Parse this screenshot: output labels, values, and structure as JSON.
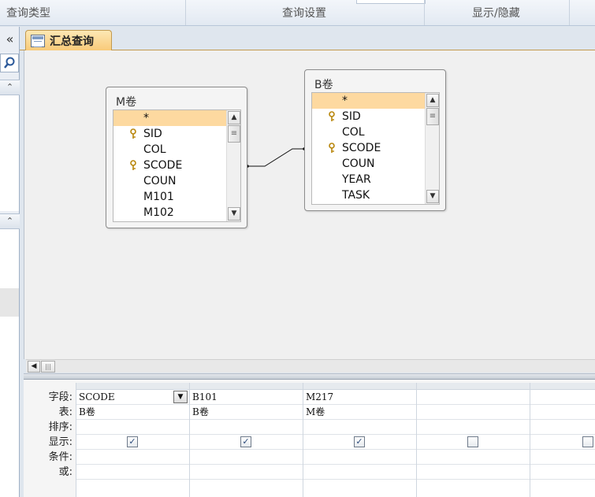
{
  "ribbon": {
    "groups": [
      "查询类型",
      "查询设置",
      "显示/隐藏"
    ]
  },
  "nav": {
    "collapse_glyph": "«",
    "section_glyph": "⌃"
  },
  "tab": {
    "title": "汇总查询",
    "accent": "#f8c977"
  },
  "tables": [
    {
      "name": "M卷",
      "fields": [
        {
          "label": "*",
          "key": false,
          "selected": true
        },
        {
          "label": "SID",
          "key": true,
          "selected": false
        },
        {
          "label": "COL",
          "key": false,
          "selected": false
        },
        {
          "label": "SCODE",
          "key": true,
          "selected": false
        },
        {
          "label": "COUN",
          "key": false,
          "selected": false
        },
        {
          "label": "M101",
          "key": false,
          "selected": false
        },
        {
          "label": "M102",
          "key": false,
          "selected": false
        }
      ]
    },
    {
      "name": "B卷",
      "fields": [
        {
          "label": "*",
          "key": false,
          "selected": true
        },
        {
          "label": "SID",
          "key": true,
          "selected": false
        },
        {
          "label": "COL",
          "key": false,
          "selected": false
        },
        {
          "label": "SCODE",
          "key": true,
          "selected": false
        },
        {
          "label": "COUN",
          "key": false,
          "selected": false
        },
        {
          "label": "YEAR",
          "key": false,
          "selected": false
        },
        {
          "label": "TASK",
          "key": false,
          "selected": false
        }
      ]
    }
  ],
  "grid": {
    "row_labels": [
      "字段:",
      "表:",
      "排序:",
      "显示:",
      "条件:",
      "或:"
    ],
    "columns": [
      {
        "field": "SCODE",
        "table": "B卷",
        "sort": "",
        "show": true,
        "has_dropdown": true
      },
      {
        "field": "B101",
        "table": "B卷",
        "sort": "",
        "show": true,
        "has_dropdown": false
      },
      {
        "field": "M217",
        "table": "M卷",
        "sort": "",
        "show": true,
        "has_dropdown": false
      },
      {
        "field": "",
        "table": "",
        "sort": "",
        "show": false,
        "has_dropdown": false
      },
      {
        "field": "",
        "table": "",
        "sort": "",
        "show": false,
        "has_dropdown": false
      }
    ],
    "check_glyph": "✓"
  }
}
